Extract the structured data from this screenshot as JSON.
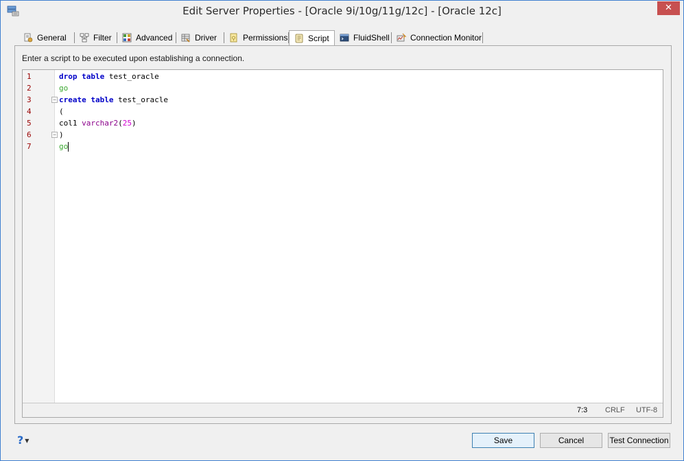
{
  "window": {
    "title": "Edit Server Properties - [Oracle 9i/10g/11g/12c] - [Oracle 12c]",
    "close_label": "✕"
  },
  "tabs": [
    {
      "label": "General",
      "icon": "general-icon"
    },
    {
      "label": "Filter",
      "icon": "filter-icon"
    },
    {
      "label": "Advanced",
      "icon": "advanced-icon"
    },
    {
      "label": "Driver",
      "icon": "driver-icon"
    },
    {
      "label": "Permissions",
      "icon": "permissions-icon"
    },
    {
      "label": "Script",
      "icon": "script-icon",
      "active": true
    },
    {
      "label": "FluidShell",
      "icon": "fluidshell-icon"
    },
    {
      "label": "Connection Monitor",
      "icon": "connection-monitor-icon"
    }
  ],
  "script_tab": {
    "instruction": "Enter a script to be executed upon establishing a connection.",
    "line_numbers": [
      "1",
      "2",
      "3",
      "4",
      "5",
      "6",
      "7"
    ],
    "lines": [
      [
        {
          "t": "drop",
          "c": "kw"
        },
        {
          "t": " ",
          "c": "plain"
        },
        {
          "t": "table",
          "c": "kw"
        },
        {
          "t": " test_oracle",
          "c": "plain"
        }
      ],
      [
        {
          "t": "go",
          "c": "go"
        }
      ],
      [
        {
          "t": "create",
          "c": "kw"
        },
        {
          "t": " ",
          "c": "plain"
        },
        {
          "t": "table",
          "c": "kw"
        },
        {
          "t": " test_oracle",
          "c": "plain"
        }
      ],
      [
        {
          "t": "(",
          "c": "plain"
        }
      ],
      [
        {
          "t": "col1 ",
          "c": "plain"
        },
        {
          "t": "varchar2",
          "c": "ty"
        },
        {
          "t": "(",
          "c": "plain"
        },
        {
          "t": "25",
          "c": "num"
        },
        {
          "t": ")",
          "c": "plain"
        }
      ],
      [
        {
          "t": ")",
          "c": "plain"
        }
      ],
      [
        {
          "t": "go",
          "c": "go"
        }
      ]
    ],
    "status": {
      "position": "7:3",
      "line_ending": "CRLF",
      "encoding": "UTF-8"
    }
  },
  "footer": {
    "help_label": "?",
    "save_label": "Save",
    "cancel_label": "Cancel",
    "test_connection_label": "Test Connection"
  },
  "colors": {
    "keyword": "#0000c8",
    "go": "#3aa82f",
    "type": "#8b008b",
    "number": "#d000d0",
    "line_number": "#990000",
    "close_button": "#c75050"
  }
}
